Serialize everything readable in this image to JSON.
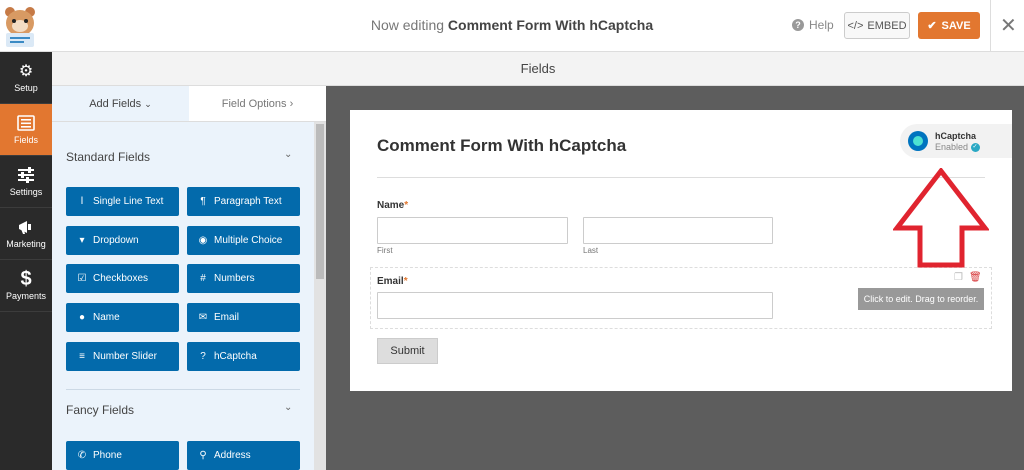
{
  "header": {
    "editing_prefix": "Now editing",
    "form_name": "Comment Form With hCaptcha",
    "help_label": "Help",
    "embed_label": "EMBED",
    "save_label": "SAVE",
    "accent_color": "#e27730"
  },
  "sidebar": {
    "items": [
      {
        "label": "Setup",
        "icon": "gear-icon"
      },
      {
        "label": "Fields",
        "icon": "fields-list-icon"
      },
      {
        "label": "Settings",
        "icon": "sliders-icon"
      },
      {
        "label": "Marketing",
        "icon": "megaphone-icon"
      },
      {
        "label": "Payments",
        "icon": "dollar-icon"
      }
    ],
    "active": "Fields"
  },
  "page": {
    "section_title": "Fields"
  },
  "panel": {
    "tabs": [
      "Add Fields",
      "Field Options"
    ],
    "sections": [
      {
        "title": "Standard Fields",
        "buttons": [
          {
            "label": "Single Line Text",
            "icon": "text-cursor-icon"
          },
          {
            "label": "Paragraph Text",
            "icon": "paragraph-icon"
          },
          {
            "label": "Dropdown",
            "icon": "dropdown-icon"
          },
          {
            "label": "Multiple Choice",
            "icon": "radio-icon"
          },
          {
            "label": "Checkboxes",
            "icon": "checkbox-icon"
          },
          {
            "label": "Numbers",
            "icon": "hash-icon"
          },
          {
            "label": "Name",
            "icon": "user-icon"
          },
          {
            "label": "Email",
            "icon": "envelope-icon"
          },
          {
            "label": "Number Slider",
            "icon": "slider-icon"
          },
          {
            "label": "hCaptcha",
            "icon": "question-icon"
          }
        ]
      },
      {
        "title": "Fancy Fields",
        "buttons": [
          {
            "label": "Phone",
            "icon": "phone-icon"
          },
          {
            "label": "Address",
            "icon": "map-pin-icon"
          }
        ]
      }
    ]
  },
  "form": {
    "title": "Comment Form With hCaptcha",
    "hcaptcha": {
      "name": "hCaptcha",
      "status": "Enabled"
    },
    "name_label": "Name",
    "first_label": "First",
    "last_label": "Last",
    "email_label": "Email",
    "required_mark": "*",
    "tooltip": "Click to edit. Drag to reorder.",
    "submit_label": "Submit"
  }
}
